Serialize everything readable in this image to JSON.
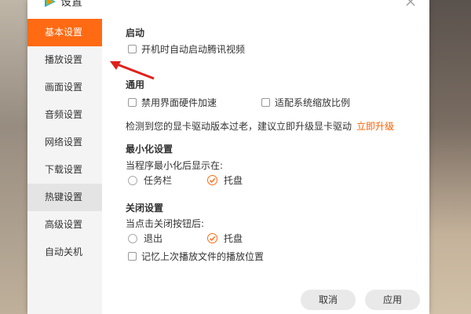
{
  "window": {
    "title": "设置"
  },
  "sidebar": {
    "items": [
      {
        "label": "基本设置",
        "state": "active"
      },
      {
        "label": "播放设置",
        "state": "normal"
      },
      {
        "label": "画面设置",
        "state": "normal"
      },
      {
        "label": "音频设置",
        "state": "normal"
      },
      {
        "label": "网络设置",
        "state": "normal"
      },
      {
        "label": "下载设置",
        "state": "normal"
      },
      {
        "label": "热键设置",
        "state": "hover"
      },
      {
        "label": "高级设置",
        "state": "normal"
      },
      {
        "label": "自动关机",
        "state": "normal"
      }
    ]
  },
  "startup": {
    "title": "启动",
    "autostart_label": "开机时自动启动腾讯视频",
    "autostart_checked": false
  },
  "general": {
    "title": "通用",
    "disable_hw_label": "禁用界面硬件加速",
    "disable_hw_checked": false,
    "scaling_label": "适配系统缩放比例",
    "scaling_checked": false,
    "driver_notice": "检测到您的显卡驱动版本过老，建议立即升级显卡驱动",
    "upgrade_link": "立即升级"
  },
  "minimize": {
    "title": "最小化设置",
    "prompt": "当程序最小化后显示在:",
    "options": [
      {
        "label": "任务栏",
        "checked": false
      },
      {
        "label": "托盘",
        "checked": true
      }
    ]
  },
  "close": {
    "title": "关闭设置",
    "prompt": "当点击关闭按钮后:",
    "options": [
      {
        "label": "退出",
        "checked": false
      },
      {
        "label": "托盘",
        "checked": true
      }
    ],
    "remember_label": "记忆上次播放文件的播放位置",
    "remember_checked": false
  },
  "footer": {
    "cancel_label": "取消",
    "apply_label": "应用"
  },
  "colors": {
    "accent": "#ff6a13",
    "link": "#ff5f00",
    "sidebar_bg": "#f4f4f4"
  }
}
